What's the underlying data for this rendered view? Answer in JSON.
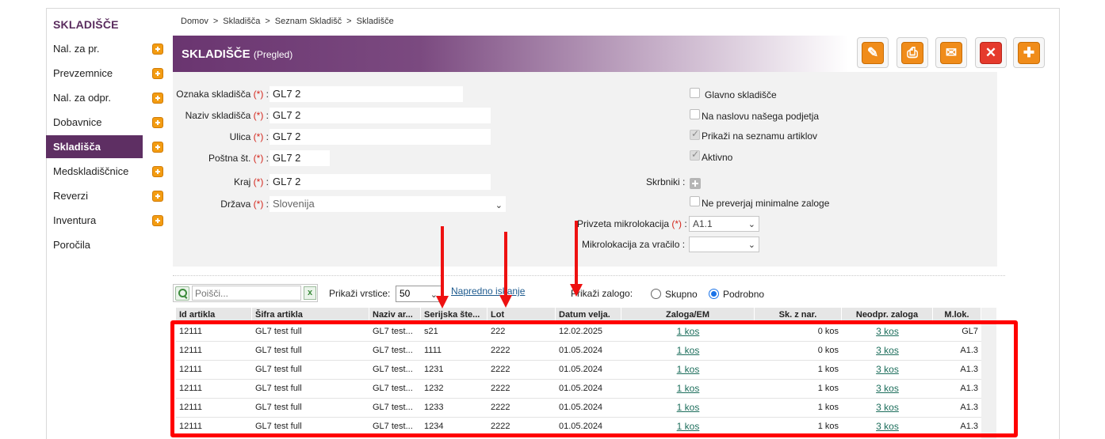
{
  "sidebar": {
    "title": "SKLADIŠČE",
    "items": [
      {
        "label": "Nal. za pr.",
        "has_add": true
      },
      {
        "label": "Prevzemnice",
        "has_add": true
      },
      {
        "label": "Nal. za odpr.",
        "has_add": true
      },
      {
        "label": "Dobavnice",
        "has_add": true
      },
      {
        "label": "Skladišča",
        "has_add": true,
        "active": true
      },
      {
        "label": "Medskladiščnice",
        "has_add": true
      },
      {
        "label": "Reverzi",
        "has_add": true
      },
      {
        "label": "Inventura",
        "has_add": true
      },
      {
        "label": "Poročila",
        "has_add": false
      }
    ]
  },
  "breadcrumb": [
    "Domov",
    "Skladišča",
    "Seznam Skladišč",
    "Skladišče"
  ],
  "breadcrumb_sep": ">",
  "header": {
    "title": "SKLADIŠČE",
    "subtitle": "(Pregled)"
  },
  "toolbar": [
    {
      "name": "edit-button",
      "icon": "pencil-icon",
      "glyph": "✎"
    },
    {
      "name": "print-button",
      "icon": "printer-icon",
      "glyph": "⎙"
    },
    {
      "name": "email-button",
      "icon": "envelope-icon",
      "glyph": "✉"
    },
    {
      "name": "delete-button",
      "icon": "close-icon",
      "glyph": "✕"
    },
    {
      "name": "add-button",
      "icon": "plus-icon",
      "glyph": "✚"
    }
  ],
  "form": {
    "required_marker": "(*)",
    "oznaka": {
      "label": "Oznaka skladišča",
      "value": "GL7 2"
    },
    "naziv": {
      "label": "Naziv skladišča",
      "value": "GL7 2"
    },
    "ulica": {
      "label": "Ulica",
      "value": "GL7 2"
    },
    "postna": {
      "label": "Poštna št.",
      "value": "GL7 2"
    },
    "kraj": {
      "label": "Kraj",
      "value": "GL7 2"
    },
    "drzava": {
      "label": "Država",
      "value": "Slovenija"
    },
    "glavno": {
      "label": "Glavno skladišče",
      "checked": false
    },
    "naslov": {
      "label": "Na naslovu našega podjetja",
      "checked": false
    },
    "prikazi": {
      "label": "Prikaži na seznamu artiklov",
      "checked": true
    },
    "aktivno": {
      "label": "Aktivno",
      "checked": true
    },
    "skrbniki": {
      "label": "Skrbniki :"
    },
    "ne_preverjaj": {
      "label": "Ne preverjaj minimalne zaloge",
      "checked": false
    },
    "privzeta": {
      "label": "Privzeta mikrolokacija",
      "value": "A1.1"
    },
    "vracilo": {
      "label": "Mikrolokacija za vračilo :",
      "value": ""
    }
  },
  "list_controls": {
    "search_placeholder": "Poišči...",
    "clear_label": "x",
    "rows_label": "Prikaži vrstice:",
    "rows_value": "50",
    "advanced_link": "Napredno iskanje",
    "stock_label": "Prikaži zalogo:",
    "stock_options": [
      {
        "label": "Skupno",
        "selected": false
      },
      {
        "label": "Podrobno",
        "selected": true
      }
    ]
  },
  "table": {
    "columns": [
      "Id artikla",
      "Šifra artikla",
      "Naziv ar...",
      "Serijska šte...",
      "Lot",
      "Datum velja.",
      "Zaloga/EM",
      "Sk. z nar.",
      "Neodpr. zaloga",
      "M.lok."
    ],
    "rows": [
      [
        "12111",
        "GL7 test full",
        "GL7 test...",
        "s21",
        "222",
        "12.02.2025",
        "1 kos",
        "0 kos",
        "3 kos",
        "GL7"
      ],
      [
        "12111",
        "GL7 test full",
        "GL7 test...",
        "1111",
        "2222",
        "01.05.2024",
        "1 kos",
        "0 kos",
        "3 kos",
        "A1.3"
      ],
      [
        "12111",
        "GL7 test full",
        "GL7 test...",
        "1231",
        "2222",
        "01.05.2024",
        "1 kos",
        "1 kos",
        "3 kos",
        "A1.3"
      ],
      [
        "12111",
        "GL7 test full",
        "GL7 test...",
        "1232",
        "2222",
        "01.05.2024",
        "1 kos",
        "1 kos",
        "3 kos",
        "A1.3"
      ],
      [
        "12111",
        "GL7 test full",
        "GL7 test...",
        "1233",
        "2222",
        "01.05.2024",
        "1 kos",
        "1 kos",
        "3 kos",
        "A1.3"
      ],
      [
        "12111",
        "GL7 test full",
        "GL7 test...",
        "1234",
        "2222",
        "01.05.2024",
        "1 kos",
        "1 kos",
        "3 kos",
        "A1.3"
      ]
    ]
  },
  "colors": {
    "brand": "#5e2f63",
    "annotation": "#ff0000",
    "accent": "#f08c1a"
  }
}
